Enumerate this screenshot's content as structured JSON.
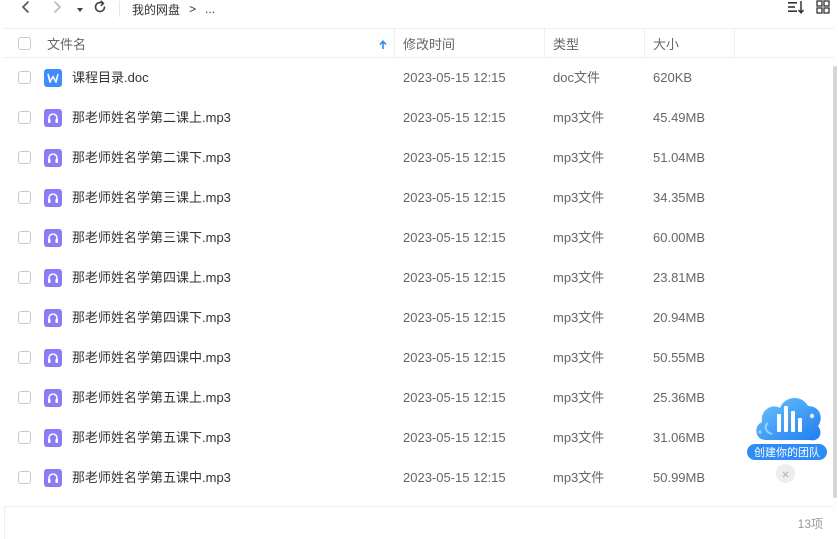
{
  "nav": {
    "back_icon": "chevron-left-icon",
    "forward_icon": "chevron-right-icon",
    "history_icon": "caret-down-icon",
    "refresh_icon": "refresh-icon",
    "breadcrumb": [
      "我的网盘",
      ">",
      "..."
    ]
  },
  "toolbar": {
    "sort_icon": "sort-icon",
    "grid_view_icon": "grid-view-icon"
  },
  "table": {
    "columns": {
      "name": "文件名",
      "modified": "修改时间",
      "type": "类型",
      "size": "大小"
    },
    "sort_indicator": "arrow-up-icon",
    "rows": [
      {
        "name": "课程目录.doc",
        "modified": "2023-05-15 12:15",
        "type": "doc文件",
        "size": "620KB",
        "icon": "word-doc-icon"
      },
      {
        "name": "那老师姓名学第二课上.mp3",
        "modified": "2023-05-15 12:15",
        "type": "mp3文件",
        "size": "45.49MB",
        "icon": "audio-file-icon"
      },
      {
        "name": "那老师姓名学第二课下.mp3",
        "modified": "2023-05-15 12:15",
        "type": "mp3文件",
        "size": "51.04MB",
        "icon": "audio-file-icon"
      },
      {
        "name": "那老师姓名学第三课上.mp3",
        "modified": "2023-05-15 12:15",
        "type": "mp3文件",
        "size": "34.35MB",
        "icon": "audio-file-icon"
      },
      {
        "name": "那老师姓名学第三课下.mp3",
        "modified": "2023-05-15 12:15",
        "type": "mp3文件",
        "size": "60.00MB",
        "icon": "audio-file-icon"
      },
      {
        "name": "那老师姓名学第四课上.mp3",
        "modified": "2023-05-15 12:15",
        "type": "mp3文件",
        "size": "23.81MB",
        "icon": "audio-file-icon"
      },
      {
        "name": "那老师姓名学第四课下.mp3",
        "modified": "2023-05-15 12:15",
        "type": "mp3文件",
        "size": "20.94MB",
        "icon": "audio-file-icon"
      },
      {
        "name": "那老师姓名学第四课中.mp3",
        "modified": "2023-05-15 12:15",
        "type": "mp3文件",
        "size": "50.55MB",
        "icon": "audio-file-icon"
      },
      {
        "name": "那老师姓名学第五课上.mp3",
        "modified": "2023-05-15 12:15",
        "type": "mp3文件",
        "size": "25.36MB",
        "icon": "audio-file-icon"
      },
      {
        "name": "那老师姓名学第五课下.mp3",
        "modified": "2023-05-15 12:15",
        "type": "mp3文件",
        "size": "31.06MB",
        "icon": "audio-file-icon"
      },
      {
        "name": "那老师姓名学第五课中.mp3",
        "modified": "2023-05-15 12:15",
        "type": "mp3文件",
        "size": "50.99MB",
        "icon": "audio-file-icon"
      }
    ]
  },
  "footer": {
    "count": "13项"
  },
  "team_widget": {
    "label": "创建你的团队",
    "icon": "team-cloud-icon",
    "close_icon": "close-icon"
  },
  "colors": {
    "accent": "#2f8cf5",
    "doc_icon": "#3f8cff",
    "audio_icon": "#8a7cf6",
    "border": "#eeeeee"
  }
}
